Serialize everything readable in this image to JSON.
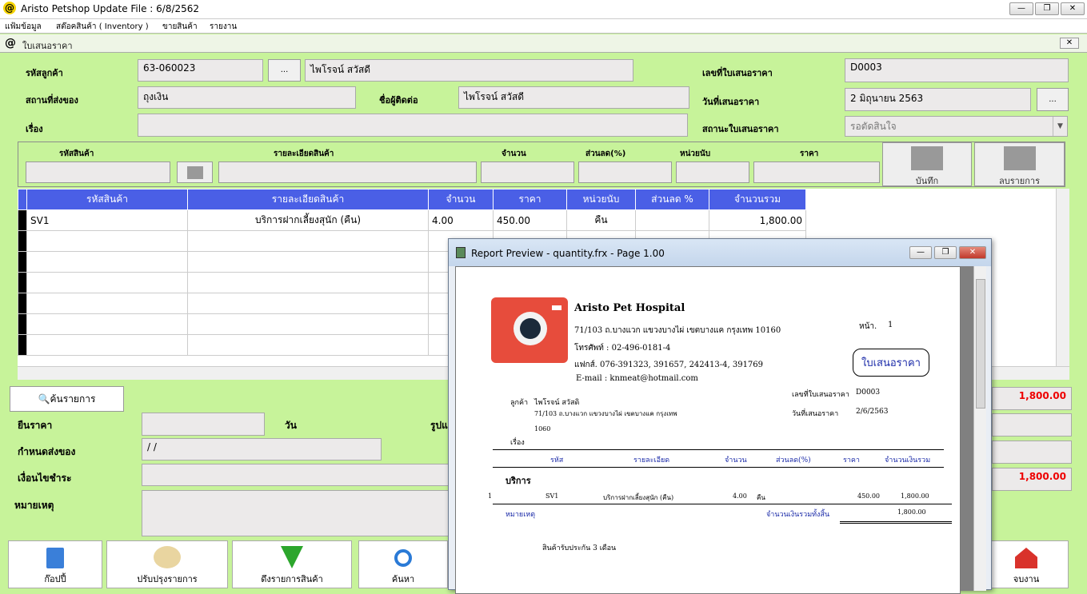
{
  "window": {
    "title": "Aristo Petshop  Update File : 6/8/2562",
    "min": "—",
    "restore": "❐",
    "close": "✕"
  },
  "menu": [
    "แฟ้มข้อมูล",
    "สต๊อคสินค้า ( Inventory )",
    "ขายสินค้า",
    "รายงาน"
  ],
  "form": {
    "title": "ใบเสนอราคา",
    "close": "✕",
    "customer_code_label": "รหัสลูกค้า",
    "customer_code": "63-060023",
    "browse": "...",
    "customer_name": "ไพโรจน์ สวัสดี",
    "delivery_place_label": "สถานที่ส่งของ",
    "delivery_place": "ถุงเงิน",
    "contact_label": "ชื่อผู้ติดต่อ",
    "contact": "ไพโรจน์ สวัสดี",
    "subject_label": "เรื่อง",
    "quote_no_label": "เลขที่ใบเสนอราคา",
    "quote_no": "D0003",
    "quote_date_label": "วันที่เสนอราคา",
    "quote_date": "2 มิถุนายน 2563",
    "status_label": "สถานะใบเสนอราคา",
    "status": "รอตัดสินใจ"
  },
  "entry": {
    "labels": [
      "รหัสสินค้า",
      "รายละเอียดสินค้า",
      "จำนวน",
      "ส่วนลด(%)",
      "หน่วยนับ",
      "ราคา"
    ],
    "save": "บันทึก",
    "delete": "ลบรายการ"
  },
  "grid": {
    "headers": [
      "รหัสสินค้า",
      "รายละเอียดสินค้า",
      "จำนวน",
      "ราคา",
      "หน่วยนับ",
      "ส่วนลด %",
      "จำนวนรวม"
    ],
    "rows": [
      [
        "SV1",
        "บริการฝากเลี้ยงสุนัก (คืน)",
        "4.00",
        "450.00",
        "คืน",
        "",
        "1,800.00"
      ]
    ]
  },
  "lower": {
    "search_btn": "ค้นรายการ",
    "valid_label": "ยืนราคา",
    "day_label": "วัน",
    "format_label": "รูปแ",
    "delivery_due_label": "กำหนดส่งของ",
    "delivery_due": " /  /",
    "payment_label": "เงื่อนไขชำระ",
    "note_label": "หมายเหตุ",
    "total1": "1,800.00",
    "total2": "1,800.00"
  },
  "buttons": [
    "ก๊อปปี้",
    "ปรับปรุงรายการ",
    "ดึงรายการสินค้า",
    "ค้นหา",
    "จบงาน"
  ],
  "report": {
    "title": "Report Preview - quantity.frx - Page 1.00",
    "company": "Aristo Pet Hospital",
    "address": "71/103 ถ.บางแวก แขวงบางไผ่ เขตบางแค กรุงเทพ 10160",
    "phone": "โทรศัพท์ : 02-496-0181-4",
    "fax": "แฟกส์.  076-391323, 391657, 242413-4, 391769",
    "email": "E-mail : knmeat@hotmail.com",
    "page_label": "หน้า.",
    "page_no": "1",
    "doc_title": "ใบเสนอราคา",
    "customer_label": "ลูกค้า",
    "customer_name": "ไพโรจน์ สวัสดิ",
    "customer_addr1": "71/103 ถ.บางแวก แขวงบางไผ่ เขตบางแค กรุงเทพ",
    "customer_addr2": "1060",
    "subject_label": "เรื่อง",
    "quote_no_label": "เลขที่ใบเสนอราคา",
    "quote_no": "D0003",
    "date_label": "วันที่เสนอราคา",
    "date": "2/6/2563",
    "cols": [
      "รหัส",
      "รายละเอียด",
      "จำนวน",
      "ส่วนลด(%)",
      "ราคา",
      "จำนวนเงินรวม"
    ],
    "group": "บริการ",
    "row": {
      "no": "1",
      "code": "SV1",
      "desc": "บริการฝากเลี้ยงสุนัก (คืน)",
      "qty": "4.00",
      "unit": "คืน",
      "price": "450.00",
      "amount": "1,800.00"
    },
    "note_label": "หมายเหตุ",
    "total_label": "จำนวนเงินรวมทั้งสิ้น",
    "total": "1,800.00",
    "warranty": "สินค้ารับประกัน 3 เดือน"
  }
}
